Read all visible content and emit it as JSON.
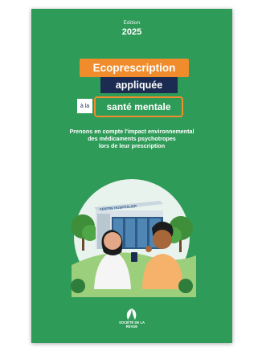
{
  "cover": {
    "edition_label": "Edition",
    "edition_year": "2025",
    "title_line1": "Ecoprescription",
    "title_line2": "appliquée",
    "title_connector": "à la",
    "title_line3": "santé mentale",
    "subtitle": [
      "Prenons en compte l'impact environnemental",
      "des médicaments psychotropes",
      "lors de leur prescription"
    ],
    "building_sign": "CENTRE HOSPITALIER",
    "logo_text": [
      "SOCIÉTÉ DE LA",
      "REVUE"
    ]
  },
  "colors": {
    "background": "#2f9b58",
    "accent_orange": "#f08c2c",
    "accent_navy": "#1b2b52",
    "text": "#ffffff"
  },
  "icons": [
    "leaf-logo-icon"
  ]
}
